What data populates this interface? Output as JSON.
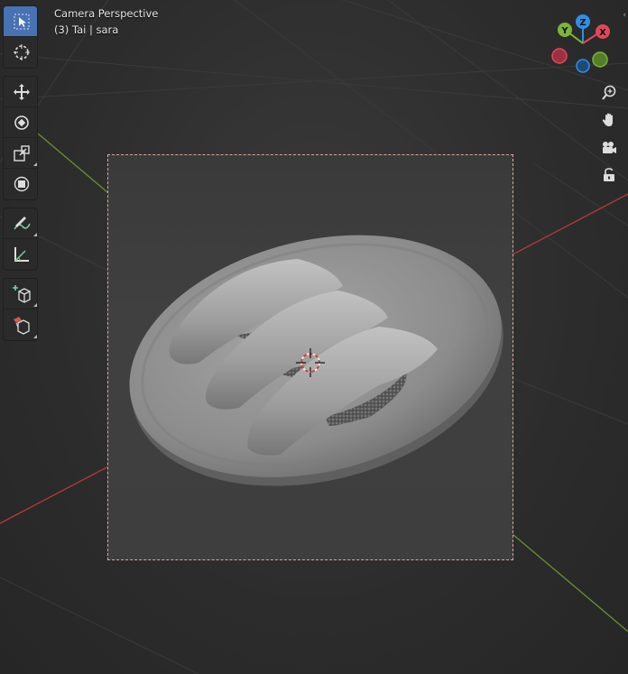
{
  "viewport": {
    "mode_label": "Camera Perspective",
    "object_label": "(3) Tai | sara"
  },
  "toolbar": {
    "groups": [
      [
        {
          "name": "select-box-tool",
          "icon": "cursor-select-icon",
          "active": true
        },
        {
          "name": "cursor-tool",
          "icon": "3d-cursor-icon",
          "active": false
        }
      ],
      [
        {
          "name": "move-tool",
          "icon": "move-icon",
          "active": false
        },
        {
          "name": "rotate-tool",
          "icon": "rotate-icon",
          "active": false
        },
        {
          "name": "scale-tool",
          "icon": "scale-icon",
          "active": false
        },
        {
          "name": "transform-tool",
          "icon": "transform-icon",
          "active": false
        }
      ],
      [
        {
          "name": "annotate-tool",
          "icon": "annotate-pencil-icon",
          "active": false
        },
        {
          "name": "measure-tool",
          "icon": "measure-ruler-icon",
          "active": false
        }
      ],
      [
        {
          "name": "add-cube-tool",
          "icon": "add-cube-icon",
          "active": false
        },
        {
          "name": "extrude-tool",
          "icon": "extrude-icon",
          "active": false
        }
      ]
    ]
  },
  "gizmo": {
    "axes": {
      "x": "X",
      "y": "Y",
      "z": "Z"
    },
    "colors": {
      "x": "#e1475a",
      "y": "#7ab53a",
      "z": "#2f8fe6"
    }
  },
  "nav_buttons": [
    "zoom-icon",
    "hand-pan-icon",
    "camera-view-icon",
    "lock-icon"
  ],
  "colors": {
    "active_tool": "#4772b3",
    "x_axis_line": "#b33a3a",
    "y_axis_line": "#6b8f2e",
    "frame_border": "#d9a7a0"
  }
}
